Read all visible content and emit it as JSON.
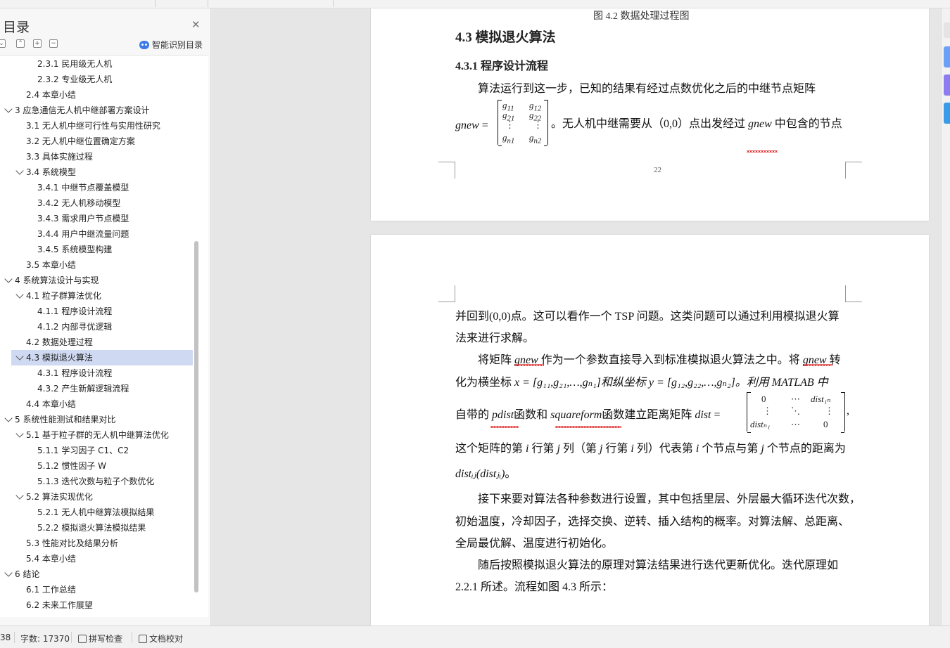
{
  "sidebar": {
    "title": "目录",
    "smart_label": "智能识别目录",
    "toc": [
      {
        "label": "2.3.1 民用级无人机",
        "level": 3,
        "expander": false,
        "selected": false
      },
      {
        "label": "2.3.2 专业级无人机",
        "level": 3,
        "expander": false,
        "selected": false
      },
      {
        "label": "2.4 本章小结",
        "level": 2,
        "expander": false,
        "selected": false
      },
      {
        "label": "3 应急通信无人机中继部署方案设计",
        "level": 1,
        "expander": true,
        "selected": false
      },
      {
        "label": "3.1 无人机中继可行性与实用性研究",
        "level": 2,
        "expander": false,
        "selected": false
      },
      {
        "label": "3.2 无人机中继位置确定方案",
        "level": 2,
        "expander": false,
        "selected": false
      },
      {
        "label": "3.3 具体实施过程",
        "level": 2,
        "expander": false,
        "selected": false
      },
      {
        "label": "3.4 系统模型",
        "level": 2,
        "expander": true,
        "selected": false
      },
      {
        "label": "3.4.1  中继节点覆盖模型",
        "level": 3,
        "expander": false,
        "selected": false
      },
      {
        "label": "3.4.2 无人机移动模型",
        "level": 3,
        "expander": false,
        "selected": false
      },
      {
        "label": "3.4.3 需求用户节点模型",
        "level": 3,
        "expander": false,
        "selected": false
      },
      {
        "label": "3.4.4  用户中继流量问题",
        "level": 3,
        "expander": false,
        "selected": false
      },
      {
        "label": "3.4.5  系统模型构建",
        "level": 3,
        "expander": false,
        "selected": false
      },
      {
        "label": "3.5 本章小结",
        "level": 2,
        "expander": false,
        "selected": false
      },
      {
        "label": "4 系统算法设计与实现",
        "level": 1,
        "expander": true,
        "selected": false
      },
      {
        "label": "4.1 粒子群算法优化",
        "level": 2,
        "expander": true,
        "selected": false
      },
      {
        "label": "4.1.1 程序设计流程",
        "level": 3,
        "expander": false,
        "selected": false
      },
      {
        "label": "4.1.2    内部寻优逻辑",
        "level": 3,
        "expander": false,
        "selected": false
      },
      {
        "label": "4.2 数据处理过程",
        "level": 2,
        "expander": false,
        "selected": false
      },
      {
        "label": "4.3 模拟退火算法",
        "level": 2,
        "expander": true,
        "selected": true
      },
      {
        "label": "4.3.1 程序设计流程",
        "level": 3,
        "expander": false,
        "selected": false
      },
      {
        "label": "4.3.2 产生新解逻辑流程",
        "level": 3,
        "expander": false,
        "selected": false
      },
      {
        "label": "4.4 本章小结",
        "level": 2,
        "expander": false,
        "selected": false
      },
      {
        "label": "5 系统性能测试和结果对比",
        "level": 1,
        "expander": true,
        "selected": false
      },
      {
        "label": "5.1 基于粒子群的无人机中继算法优化",
        "level": 2,
        "expander": true,
        "selected": false
      },
      {
        "label": "5.1.1 学习因子 C1、C2",
        "level": 3,
        "expander": false,
        "selected": false
      },
      {
        "label": "5.1.2 惯性因子 W",
        "level": 3,
        "expander": false,
        "selected": false
      },
      {
        "label": "5.1.3 迭代次数与粒子个数优化",
        "level": 3,
        "expander": false,
        "selected": false
      },
      {
        "label": "5.2 算法实现优化",
        "level": 2,
        "expander": true,
        "selected": false
      },
      {
        "label": "5.2.1 无人机中继算法模拟结果",
        "level": 3,
        "expander": false,
        "selected": false
      },
      {
        "label": "5.2.2 模拟退火算法模拟结果",
        "level": 3,
        "expander": false,
        "selected": false
      },
      {
        "label": "5.3 性能对比及结果分析",
        "level": 2,
        "expander": false,
        "selected": false
      },
      {
        "label": "5.4 本章小结",
        "level": 2,
        "expander": false,
        "selected": false
      },
      {
        "label": "6 结论",
        "level": 1,
        "expander": true,
        "selected": false
      },
      {
        "label": "6.1 工作总结",
        "level": 2,
        "expander": false,
        "selected": false
      },
      {
        "label": "6.2 未来工作展望",
        "level": 2,
        "expander": false,
        "selected": false
      }
    ]
  },
  "page1": {
    "top_caption": "图 4.2 数据处理过程图",
    "heading": "4.3 模拟退火算法",
    "subheading": "4.3.1 程序设计流程",
    "p1": "算法运行到这一步，已知的结果有经过点数优化之后的中继节点矩阵",
    "gnew": "gnew",
    "eq": " = ",
    "after_matrix": "。无人机中继需要从（0,0）点出发经过 ",
    "gnew2": "gnew",
    "tail": " 中包含的节点",
    "page_number": "22",
    "m_g11": "g",
    "m_s11": "11",
    "m_s12": "12",
    "m_s21": "21",
    "m_s22": "22",
    "m_sn1": "n1",
    "m_sn2": "n2",
    "vdots": "⋮"
  },
  "page2": {
    "l1": "并回到(0,0)点。这可以看作一个 TSP 问题。这类问题可以通过利用模拟退火算",
    "l2": "法来进行求解。",
    "l3a": "将矩阵 ",
    "l3b": "gnew",
    "l3c": " 作为一个参数直接导入到标准模拟退火算法之中。将 ",
    "l3d": "gnew",
    "l3e": " 转",
    "l4a": "化为横坐标 ",
    "l4b": "x",
    "l4c": " = [g₁₁,g₂₁,…,gₙ₁]和纵坐标 ",
    "l4d": "y",
    "l4e": " = [g₁₂,g₂₂,…,gₙ₂]。利用 MATLAB 中",
    "l5a": "自带的 ",
    "l5b": "pdist",
    "l5c": "函数和 ",
    "l5d": "squareform",
    "l5e": "函数建立距离矩阵 ",
    "l5f": "dist",
    "l5g": " = ",
    "l5h": ",",
    "m_zero": "0",
    "m_cdots": "⋯",
    "m_dist1n": "dist₁ₙ",
    "m_vdots": "⋮",
    "m_ddots": "⋱",
    "m_distn1": "distₙ₁",
    "l6a": "这个矩阵的第 ",
    "l6b": "i",
    "l6c": " 行第 ",
    "l6d": "j",
    "l6e": " 列（第 ",
    "l6f": "j",
    "l6g": " 行第 ",
    "l6h": "i",
    "l6i": " 列）代表第 ",
    "l6j": "i",
    "l6k": " 个节点与第 ",
    "l6l": "j",
    "l6m": " 个节点的距离为",
    "l7a": "distᵢⱼ(distⱼᵢ)",
    "l7b": "。",
    "l8": "接下来要对算法各种参数进行设置，其中包括里层、外层最大循环迭代次数，",
    "l9": "初始温度，冷却因子，选择交换、逆转、插入结构的概率。对算法解、总距离、",
    "l10": "全局最优解、温度进行初始化。",
    "l11": "随后按照模拟退火算法的原理对算法结果进行迭代更新优化。迭代原理如",
    "l12": "2.2.1 所述。流程如图 4.3 所示："
  },
  "status": {
    "page": "38",
    "word_count": "字数: 17370",
    "spell_check": "拼写检查",
    "doc_proof": "文档校对"
  },
  "colors": {
    "selected_bg": "#cfdaf2",
    "accent_blue": "#3b7be6",
    "squiggle": "#dd3333",
    "right_btn_1": "#6aa0f5",
    "right_btn_2": "#8b7cf0",
    "right_btn_3": "#3a9be8"
  }
}
